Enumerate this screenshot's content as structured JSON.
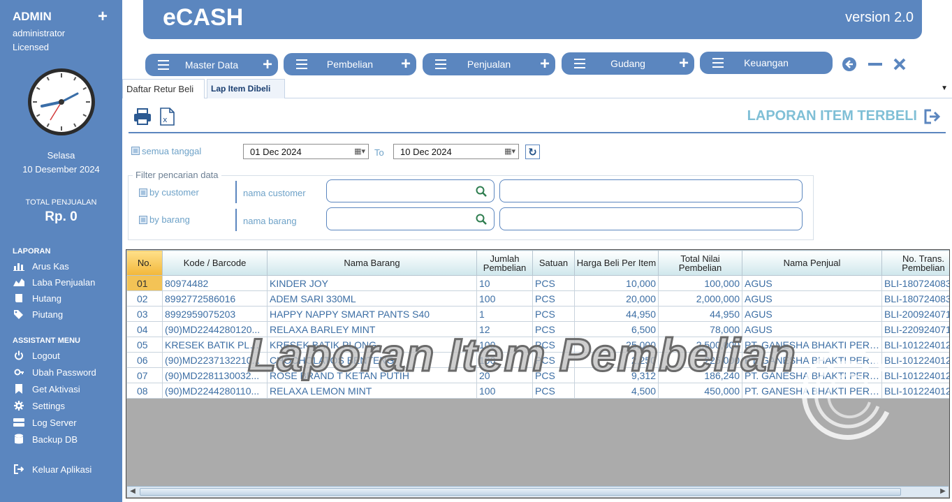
{
  "sidebar": {
    "user": "ADMIN",
    "role": "administrator",
    "license": "Licensed",
    "day": "Selasa",
    "date": "10 Desember 2024",
    "total_label": "TOTAL PENJUALAN",
    "total_value": "Rp. 0",
    "laporan_title": "LAPORAN",
    "laporan_items": [
      "Arus Kas",
      "Laba Penjualan",
      "Hutang",
      "Piutang"
    ],
    "assistant_title": "ASSISTANT MENU",
    "assistant_items": [
      "Logout",
      "Ubah Password",
      "Get Aktivasi",
      "Settings",
      "Log Server",
      "Backup DB"
    ],
    "exit_label": "Keluar Aplikasi"
  },
  "header": {
    "title": "eCASH",
    "version": "version 2.0"
  },
  "menu": [
    "Master Data",
    "Pembelian",
    "Penjualan",
    "Gudang",
    "Keuangan"
  ],
  "tabs": [
    "Daftar Retur Beli",
    "Lap Item Dibeli"
  ],
  "report_title": "LAPORAN ITEM TERBELI",
  "filters": {
    "all_dates": "semua tanggal",
    "date_from": "01 Dec 2024",
    "to_label": "To",
    "date_to": "10 Dec 2024",
    "group_label": "Filter pencarian data",
    "by_customer": "by customer",
    "customer_label": "nama customer",
    "by_barang": "by barang",
    "barang_label": "nama barang"
  },
  "table": {
    "headers": [
      "No.",
      "Kode / Barcode",
      "Nama Barang",
      "Jumlah Pembelian",
      "Satuan",
      "Harga Beli Per Item",
      "Total Nilai Pembelian",
      "Nama Penjual",
      "No. Trans. Pembelian"
    ],
    "rows": [
      [
        "01",
        "80974482",
        "KINDER JOY",
        "10",
        "PCS",
        "10,000",
        "100,000",
        "AGUS",
        "BLI-180724083"
      ],
      [
        "02",
        "8992772586016",
        "ADEM SARI 330ML",
        "100",
        "PCS",
        "20,000",
        "2,000,000",
        "AGUS",
        "BLI-180724083"
      ],
      [
        "03",
        "8992959075203",
        "HAPPY NAPPY SMART PANTS S40",
        "1",
        "PCS",
        "44,950",
        "44,950",
        "AGUS",
        "BLI-200924071"
      ],
      [
        "04",
        "(90)MD2244280120...",
        "RELAXA BARLEY MINT",
        "12",
        "PCS",
        "6,500",
        "78,000",
        "AGUS",
        "BLI-220924071"
      ],
      [
        "05",
        " KRESEK BATIK PLONG",
        "KRESEK BATIK PLONG",
        "100",
        "PCS",
        "25,000",
        "2,500,000",
        "PT. GANESHA BHAKTI PERSA...",
        "BLI-101224012"
      ],
      [
        "06",
        "(90)MD2237132210...",
        "CHOCHOLATOS BENTENG",
        "100",
        "PCS",
        "2,250",
        "225,000",
        "PT. GANESHA BHAKTI PERSA...",
        "BLI-101224012"
      ],
      [
        "07",
        "(90)MD2281130032...",
        "ROSE BRAND T KETAN PUTIH",
        "20",
        "PCS",
        "9,312",
        "186,240",
        "PT. GANESHA BHAKTI PERSA...",
        "BLI-101224012"
      ],
      [
        "08",
        "(90)MD2244280110...",
        "RELAXA LEMON MINT",
        "100",
        "PCS",
        "4,500",
        "450,000",
        "PT. GANESHA BHAKTI PERSA...",
        "BLI-101224012"
      ]
    ]
  },
  "watermark": "Laporan Item Pembelian",
  "logo": {
    "name": "e-cash",
    "tagline": "smart application"
  },
  "colors": {
    "primary": "#5b86bf",
    "title": "#7fbfd6",
    "cell_text": "#3c6ea4"
  }
}
